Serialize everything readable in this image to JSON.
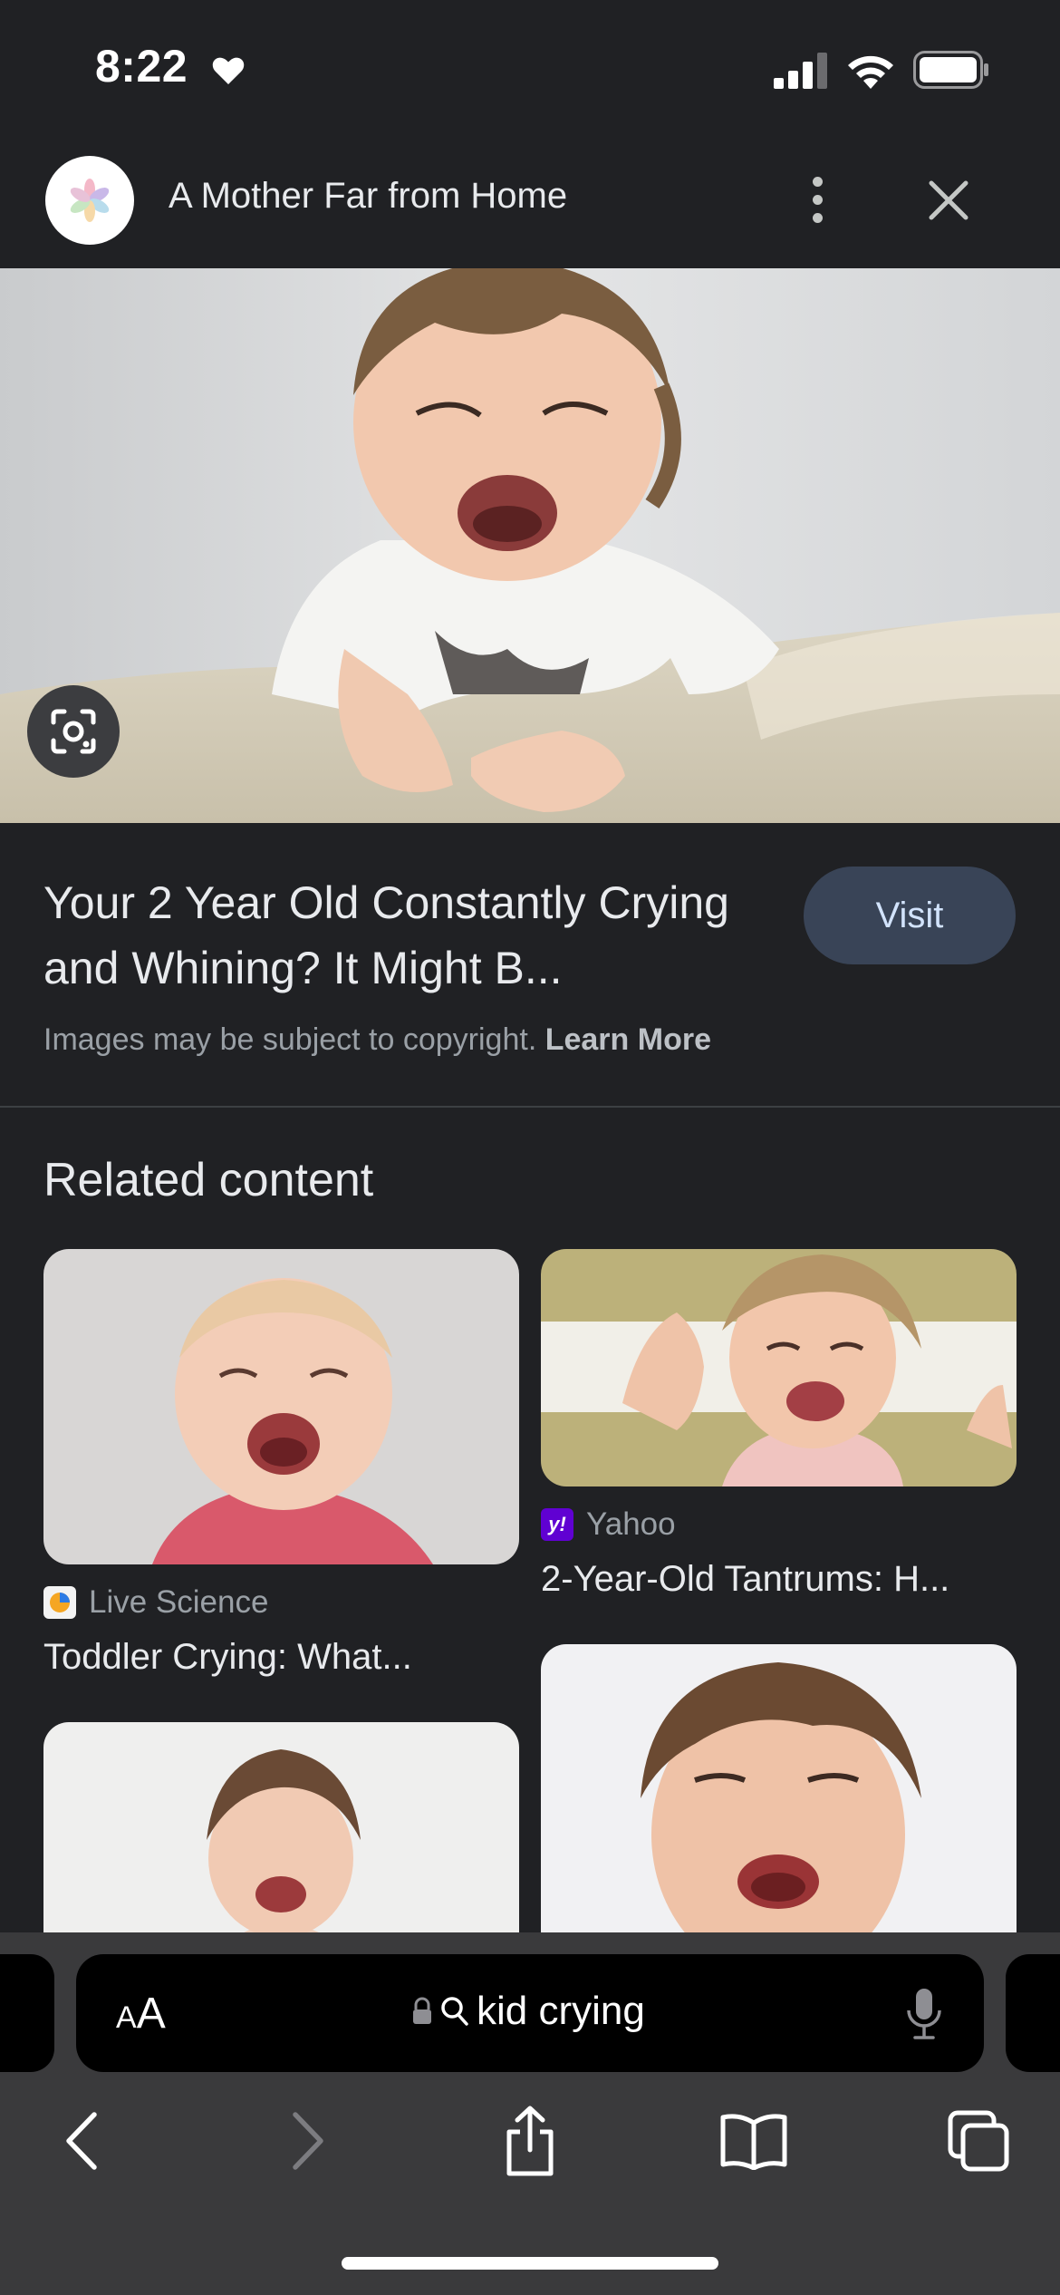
{
  "status_bar": {
    "time": "8:22"
  },
  "header": {
    "site_name": "A Mother Far from Home",
    "icons": [
      "site-logo",
      "more-vert-icon",
      "close-icon"
    ]
  },
  "hero": {
    "alt": "",
    "lens_icon": "google-lens-icon"
  },
  "result": {
    "title": "Your 2 Year Old Constantly Crying and Whining? It Might B...",
    "visit_label": "Visit",
    "copyright_text": "Images may be subject to copyright.",
    "learn_more": "Learn More"
  },
  "related": {
    "heading": "Related content",
    "cards": [
      {
        "source": "Live Science",
        "title": "Toddler Crying: What...",
        "favicon": "live-science-icon"
      },
      {
        "source": "Yahoo",
        "title": "2-Year-Old Tantrums: H...",
        "favicon": "yahoo-icon"
      },
      {
        "source": "",
        "title": "",
        "favicon": ""
      },
      {
        "source": "",
        "title": "",
        "favicon": ""
      }
    ]
  },
  "browser": {
    "text_size_label": "AA",
    "search_query": "kid crying",
    "nav_icons": [
      "back-icon",
      "forward-icon",
      "share-icon",
      "bookmarks-icon",
      "tabs-icon"
    ]
  },
  "colors": {
    "background": "#202124",
    "visit_button": "#394457",
    "chrome": "#3a3a3c"
  }
}
